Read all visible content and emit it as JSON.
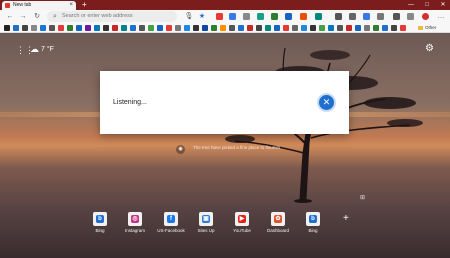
{
  "browser": {
    "tab_title": "New tab",
    "tab_close": "×",
    "new_tab": "+",
    "minimize": "—",
    "restore": "□",
    "close": "✕",
    "back": "←",
    "forward": "→",
    "refresh": "↻",
    "address_placeholder": "Search or enter web address",
    "search_icon": "⌕",
    "mic_icon": "🎙",
    "favorite_icon": "★",
    "settings_more": "…",
    "other_favorites": "Other favorites"
  },
  "ntp": {
    "apps_icon": "⋮⋮",
    "weather_icon": "☁",
    "temperature": "7 °F",
    "settings_icon": "⚙",
    "image_caption": "The tree have picked a fine place to flourish",
    "camera_icon": "◉",
    "add_link": "+",
    "quick_links": [
      {
        "label": "Bing",
        "color": "#1e6fd0",
        "glyph": "b"
      },
      {
        "label": "Instagram",
        "color": "#c13584",
        "glyph": "◎"
      },
      {
        "label": "US-Facebook",
        "color": "#1877f2",
        "glyph": "f"
      },
      {
        "label": "Sites Up",
        "color": "#2a7fd4",
        "glyph": "▣"
      },
      {
        "label": "YouTube",
        "color": "#e62117",
        "glyph": "▶"
      },
      {
        "label": "Dashboard",
        "color": "#d9552b",
        "glyph": "✿"
      },
      {
        "label": "Bing",
        "color": "#1e6fd0",
        "glyph": "b"
      }
    ]
  },
  "dialog": {
    "status": "Listening...",
    "stop_icon": "✕"
  },
  "colors": {
    "accent": "#1e6fd0",
    "titlebar": "#7c1d1d"
  }
}
